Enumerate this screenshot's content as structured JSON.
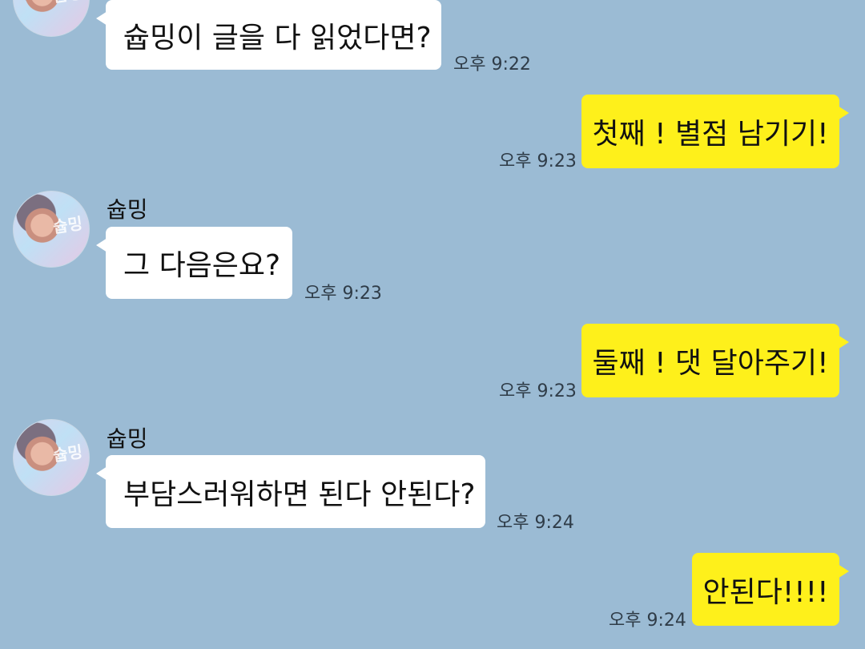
{
  "chat": {
    "colors": {
      "background": "#9bbbd4",
      "incoming_bubble": "#ffffff",
      "outgoing_bubble": "#fef01b",
      "text": "#111111",
      "time": "#2f3c48"
    },
    "messages": [
      {
        "direction": "incoming",
        "sender": "",
        "text": "슙밍이 글을 다 읽었다면?",
        "time": "오후 9:22"
      },
      {
        "direction": "outgoing",
        "text": "첫째 ! 별점 남기기!",
        "time": "오후 9:23"
      },
      {
        "direction": "incoming",
        "sender": "슙밍",
        "text": "그 다음은요?",
        "time": "오후 9:23"
      },
      {
        "direction": "outgoing",
        "text": "둘째 ! 댓 달아주기!",
        "time": "오후 9:23"
      },
      {
        "direction": "incoming",
        "sender": "슙밍",
        "text": "부담스러워하면 된다 안된다?",
        "time": "오후 9:24"
      },
      {
        "direction": "outgoing",
        "text": "안된다!!!!",
        "time": "오후 9:24"
      }
    ],
    "avatar_watermark": "슙밍"
  }
}
